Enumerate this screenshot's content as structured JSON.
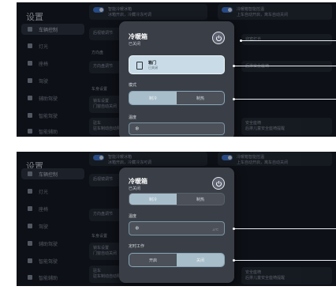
{
  "settings": {
    "title": "设置",
    "sidebar": [
      {
        "label": "车辆控制",
        "icon": "car-control-icon",
        "active": true
      },
      {
        "label": "灯光",
        "icon": "light-icon",
        "active": false
      },
      {
        "label": "座椅",
        "icon": "seat-icon",
        "active": false
      },
      {
        "label": "驾驶",
        "icon": "drive-icon",
        "active": false
      },
      {
        "label": "辅助驾驶",
        "icon": "assist-icon",
        "active": false
      },
      {
        "label": "智能驾驶",
        "icon": "smart-drive-icon",
        "active": false
      },
      {
        "label": "智能辅助",
        "icon": "smart-assist-icon",
        "active": false
      }
    ],
    "bg_items": {
      "toggle_item_1": "智能冷暖冰箱",
      "toggle_item_1_sub": "冰箱开启，冷藏冷冻可调",
      "toggle_item_2": "冷暖箱智能控温",
      "toggle_item_2_sub": "上车自动开启，离车自动关闭",
      "row_a": "后视镜调节",
      "section_1": "方向盘",
      "row_b": "方向盘调节",
      "section_2": "车身设置",
      "row_c": "锁车设置",
      "row_c_sub": "门窗自动关闭",
      "row_d": "驻车",
      "row_d_sub": "驻车制动自动释放",
      "right_1": "迎宾灯光",
      "right_2": "后排安全座椅",
      "right_3": "安全座椅",
      "right_3_sub": "后排儿童安全座椅提醒"
    }
  },
  "dialog_top": {
    "title": "冷暖箱",
    "status": "已关闭",
    "door_card": {
      "label": "箱门",
      "status": "已关闭",
      "icon": "door-icon"
    },
    "mode_label": "模式",
    "mode_options": [
      "制冷",
      "制热"
    ],
    "mode_selected": "制热",
    "temp_label": "温度",
    "temp_icon": "snowflake-icon",
    "power_icon": "power-icon"
  },
  "dialog_bottom": {
    "title": "冷暖箱",
    "status": "已关闭",
    "mode_options": [
      "制冷",
      "制热"
    ],
    "temp_label": "温度",
    "temp_value": "-8℃",
    "temp_icon": "snowflake-icon",
    "timer_label": "定时工作",
    "timer_options": [
      "开启",
      "关闭"
    ],
    "timer_selected": "关闭",
    "power_icon": "power-icon"
  },
  "colors": {
    "background": "#0d1016",
    "dialog": "#3a3f47",
    "selected_segment": "#a7bdca",
    "accent": "#3b7be0"
  }
}
